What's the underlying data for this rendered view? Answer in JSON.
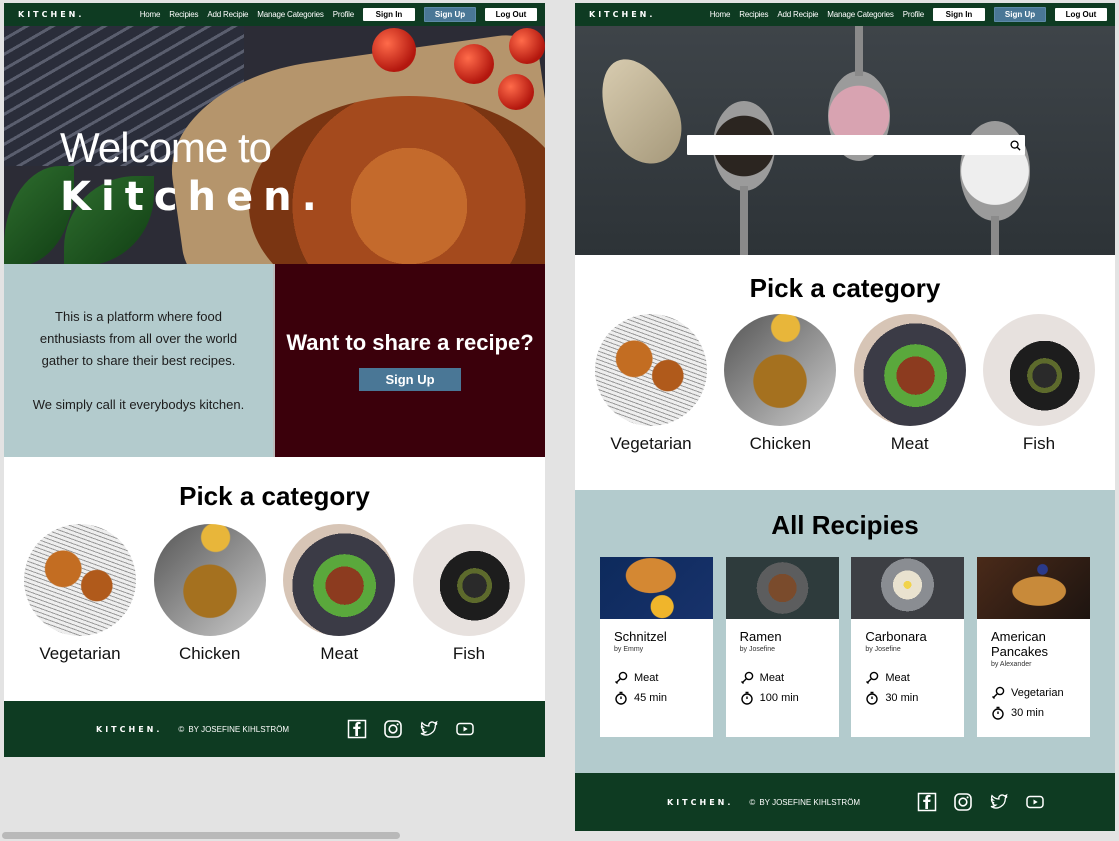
{
  "nav": {
    "logo": "KITCHEN.",
    "links": [
      "Home",
      "Recipies",
      "Add Recipie",
      "Manage Categories",
      "Profile"
    ],
    "sign_in": "Sign In",
    "sign_up": "Sign Up",
    "log_out": "Log Out"
  },
  "hero": {
    "welcome": "Welcome to",
    "brand": "Kitchen."
  },
  "intro": {
    "paragraph1": "This is a platform where food enthusiasts from all over the world gather to share their best recipes.",
    "paragraph2": "We simply call it everybodys kitchen.",
    "share_heading": "Want to share a recipe?",
    "signup_button": "Sign Up"
  },
  "search": {
    "placeholder": ""
  },
  "categories": {
    "title": "Pick a category",
    "items": [
      "Vegetarian",
      "Chicken",
      "Meat",
      "Fish"
    ]
  },
  "recipes": {
    "title": "All Recipies",
    "items": [
      {
        "name": "Schnitzel",
        "by": "by Emmy",
        "category": "Meat",
        "time": "45 min"
      },
      {
        "name": "Ramen",
        "by": "by Josefine",
        "category": "Meat",
        "time": "100 min"
      },
      {
        "name": "Carbonara",
        "by": "by Josefine",
        "category": "Meat",
        "time": "30 min"
      },
      {
        "name": "American Pancakes",
        "by": "by Alexander",
        "category": "Vegetarian",
        "time": "30 min"
      }
    ]
  },
  "footer": {
    "logo": "KITCHEN.",
    "copyright": "©",
    "credit": "BY JOSEFINE KIHLSTRÖM",
    "socials": [
      "facebook-icon",
      "instagram-icon",
      "twitter-icon",
      "youtube-icon"
    ]
  },
  "colors": {
    "nav_green": "#0e3b22",
    "maroon": "#3b000b",
    "teal_bg": "#b3cbcd",
    "button_blue": "#4a7796"
  }
}
